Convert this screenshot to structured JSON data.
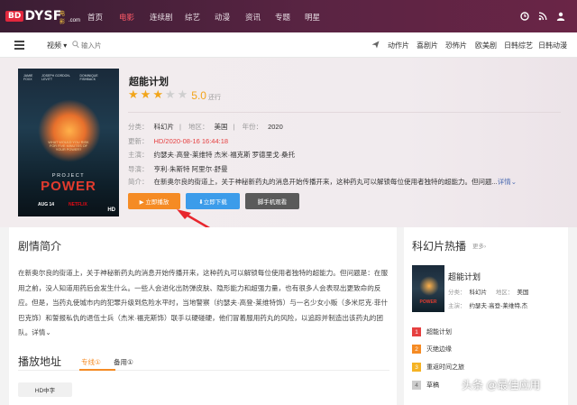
{
  "logo": {
    "badge": "BD",
    "name": "DYSF",
    "sub": "电影",
    "domain": ".com"
  },
  "nav": [
    "首页",
    "电影",
    "连续剧",
    "综艺",
    "动漫",
    "资讯",
    "专题",
    "明星"
  ],
  "nav_active": 1,
  "topicons": [
    "clock-icon",
    "rss-icon",
    "user-icon"
  ],
  "subbar": {
    "dropdown": "视频",
    "search_placeholder": "输入片",
    "quick_links": [
      "动作片",
      "喜剧片",
      "恐怖片",
      "欧美剧",
      "日韩综艺",
      "日韩动漫"
    ]
  },
  "poster": {
    "names": [
      "JAMIE FOXX",
      "JOSEPH GORDON-LEVITT",
      "DOMINIQUE FISHBACK"
    ],
    "tagline": "WHAT WOULD YOU RISK FOR FIVE MINUTES OF YOUR POWER?",
    "project": "PROJECT",
    "power": "POWER",
    "date": "AUG 14",
    "platform": "NETFLIX",
    "quality": "HD"
  },
  "movie": {
    "title": "超能计划",
    "rating": 3,
    "score": "5.0",
    "score_unit": "还行",
    "category_key": "分类：",
    "category": "科幻片",
    "region_key": "地区：",
    "region": "美国",
    "year_key": "年份：",
    "year": "2020",
    "updated_key": "更新：",
    "updated": "HD/2020-08-16 16:44:18",
    "cast_key": "主演：",
    "cast": "约瑟夫·高登-莱维特 杰米·福克斯 罗德里戈·桑托",
    "director_key": "导演：",
    "director": "亨利·朱斯特 阿里尔·舒曼",
    "plot_key": "简介：",
    "plot": "在新奥尔良的街道上，关于神秘新药丸的消息开始传播开来，这种药丸可以解锁每位使用者独特的超能力。但问题...",
    "more": "详情"
  },
  "buttons": {
    "play": "▶ 立即播放",
    "download": "⬇立即下载",
    "mobile": "脚手机观看"
  },
  "synopsis": {
    "heading": "剧情简介",
    "text": "在新奥尔良的街道上，关于神秘新药丸的消息开始传播开来，这种药丸可以解锁每位使用者独特的超能力。但问题是：在服用之前，没人知道用药后会发生什么。一些人会进化出防弹皮肤、隐形能力和超强力量，也有很多人会表现出更致命的反应。但是，当药丸使城市内的犯罪升级到危险水平时，当地警察（约瑟夫·高登-莱维特饰）与一名少女小贩（多米尼克·菲什巴克饰）和誓报私仇的退伍士兵（杰米·福克斯饰）联手以硬碰硬，他们冒着服用药丸的风险，以追踪并制造出该药丸的团队。详情",
    "more": "详情"
  },
  "playlist": {
    "heading": "播放地址",
    "tabs": [
      "专线①",
      "备用①"
    ],
    "episode": "HD中字"
  },
  "sidebar": {
    "heading": "科幻片热播",
    "more": "更多",
    "featured": {
      "title": "超能计划",
      "category_key": "分类：",
      "category": "科幻片",
      "region_key": "地区：",
      "region": "美国",
      "cast_key": "主演：",
      "cast": "约瑟夫·高登-莱维特,杰"
    },
    "ranks": [
      {
        "n": "1",
        "title": "超能计划"
      },
      {
        "n": "2",
        "title": "灭绝边缘"
      },
      {
        "n": "3",
        "title": "重返时间之旅"
      },
      {
        "n": "4",
        "title": "草稿"
      }
    ]
  },
  "watermark": "头条 @最佳应用"
}
